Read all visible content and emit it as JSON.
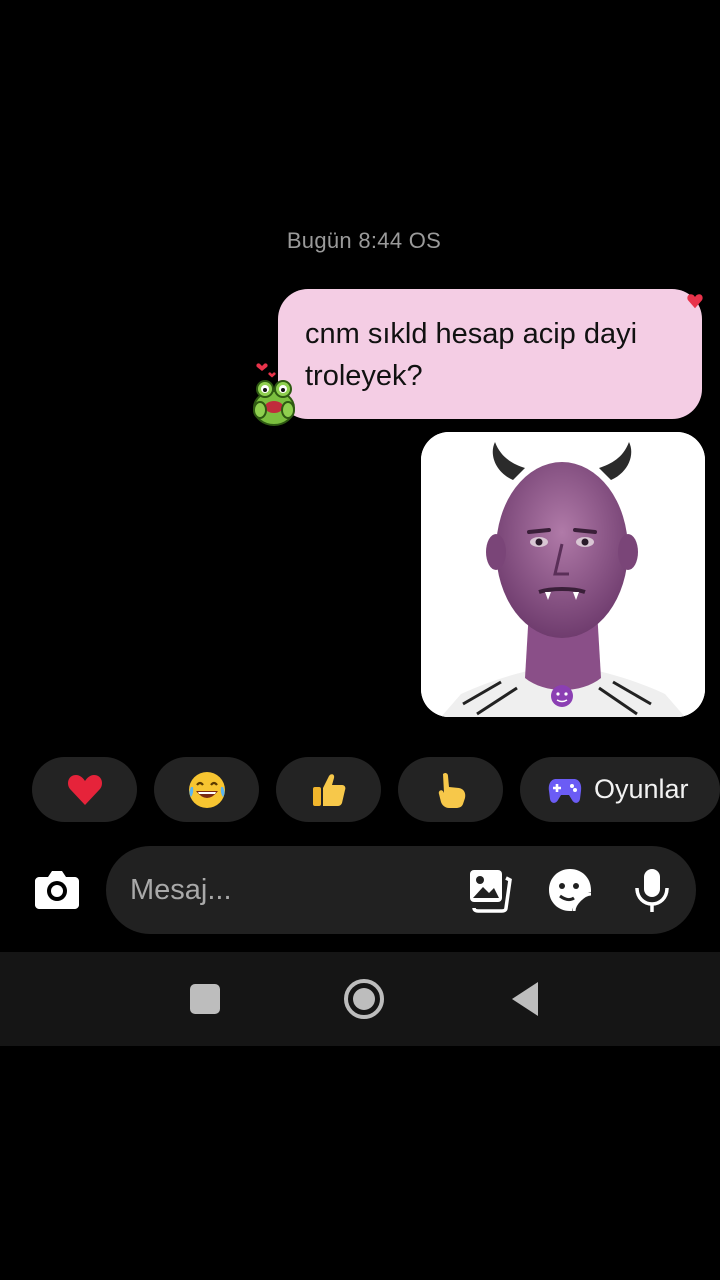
{
  "chat": {
    "timestamp": "Bugün 8:44 OS",
    "messages": [
      {
        "type": "text",
        "direction": "outgoing",
        "text": "cnm sıkld hesap acip dayi troleyek?",
        "bubble_color": "#f4cde4",
        "reaction_icon": "frog-sticker-icon"
      },
      {
        "type": "image",
        "direction": "outgoing",
        "icon": "devil-edited-photo"
      }
    ]
  },
  "quick_reactions": [
    {
      "icon": "red-heart-icon"
    },
    {
      "icon": "tears-of-joy-icon"
    },
    {
      "icon": "thumbs-up-icon"
    },
    {
      "icon": "pointing-hand-icon"
    },
    {
      "icon": "game-controller-icon",
      "label": "Oyunlar",
      "accent": "#6b5cf5"
    }
  ],
  "composer": {
    "placeholder": "Mesaj...",
    "icons": [
      "camera-icon",
      "gallery-icon",
      "sticker-icon",
      "microphone-icon"
    ]
  },
  "system_nav": {
    "icons": [
      "recents-icon",
      "home-icon",
      "back-icon"
    ]
  },
  "colors": {
    "background": "#000000",
    "bubble": "#f4cde4",
    "chip": "#232323",
    "input_bar": "#212121",
    "nav_bar": "#151515"
  }
}
